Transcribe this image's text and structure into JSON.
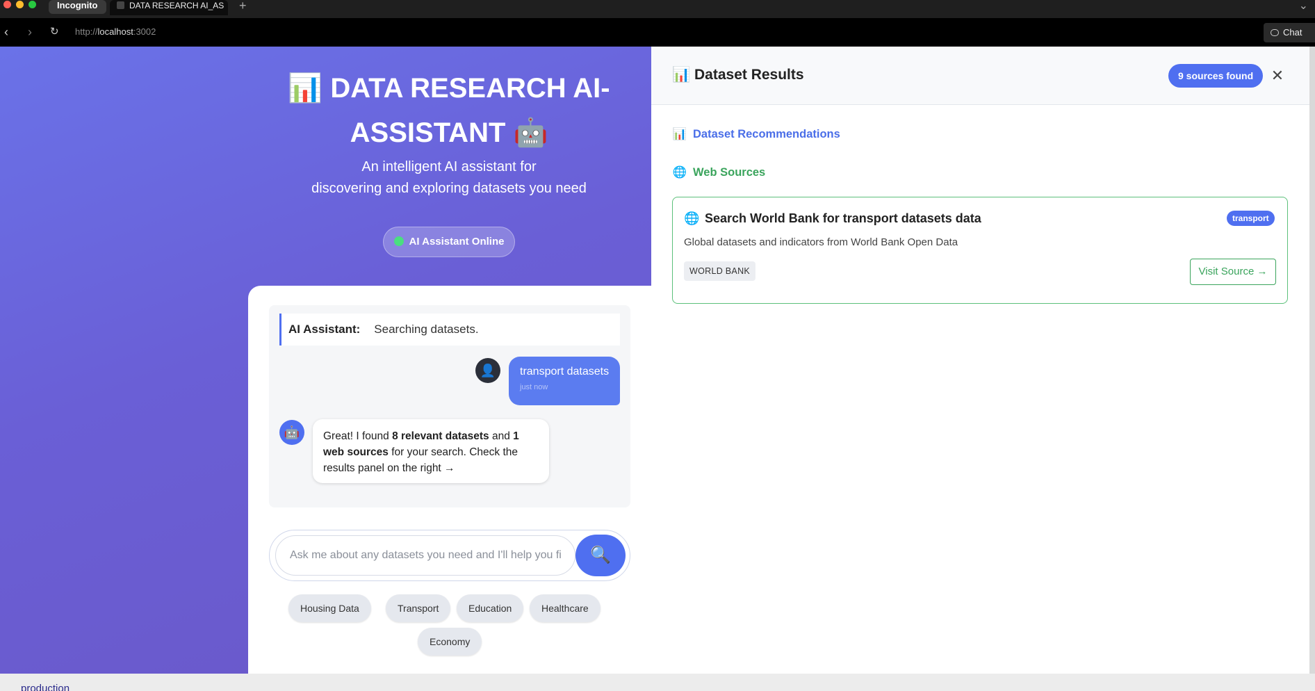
{
  "browser": {
    "incognito_label": "Incognito",
    "tab_title": "DATA RESEARCH AI_AS",
    "url_scheme": "http://",
    "url_host": "localhost",
    "url_port": ":3002",
    "chat_button": "Chat"
  },
  "hero": {
    "title_icon": "📊",
    "title_line1": "DATA RESEARCH AI-",
    "title_line2": "ASSISTANT",
    "title_icon_end": "🤖",
    "subtitle_line1": "An intelligent AI assistant for",
    "subtitle_line2": "discovering and exploring datasets you need",
    "status": "AI Assistant Online"
  },
  "chat": {
    "system_label": "AI Assistant:",
    "system_text": "Searching datasets.",
    "user_message": "transport datasets",
    "user_time": "just now",
    "bot_text_1": "Great! I found ",
    "bot_bold_1": "8 relevant datasets",
    "bot_text_2": " and ",
    "bot_bold_2": "1 web sources",
    "bot_text_3": " for your search. Check the results panel on the right →",
    "input_placeholder": "Ask me about any datasets you need and I'll help you find them",
    "send_icon": "🔍"
  },
  "quick_chips": [
    "Housing Data",
    "Transport",
    "Education",
    "Healthcare",
    "Economy"
  ],
  "results": {
    "title_icon": "📊",
    "title": "Dataset Results",
    "count": "9 sources found",
    "close": "✕",
    "section_recommendations": "Dataset Recommendations",
    "section_web": "Web Sources",
    "source": {
      "title": "Search World Bank for transport datasets data",
      "tag": "transport",
      "description": "Global datasets and indicators from World Bank Open Data",
      "badge": "WORLD BANK",
      "visit": "Visit Source →"
    }
  },
  "footer_text": "production",
  "colors": {
    "accent": "#4f6ff0",
    "web_green": "#3aa45c",
    "online_dot": "#4ade80"
  }
}
